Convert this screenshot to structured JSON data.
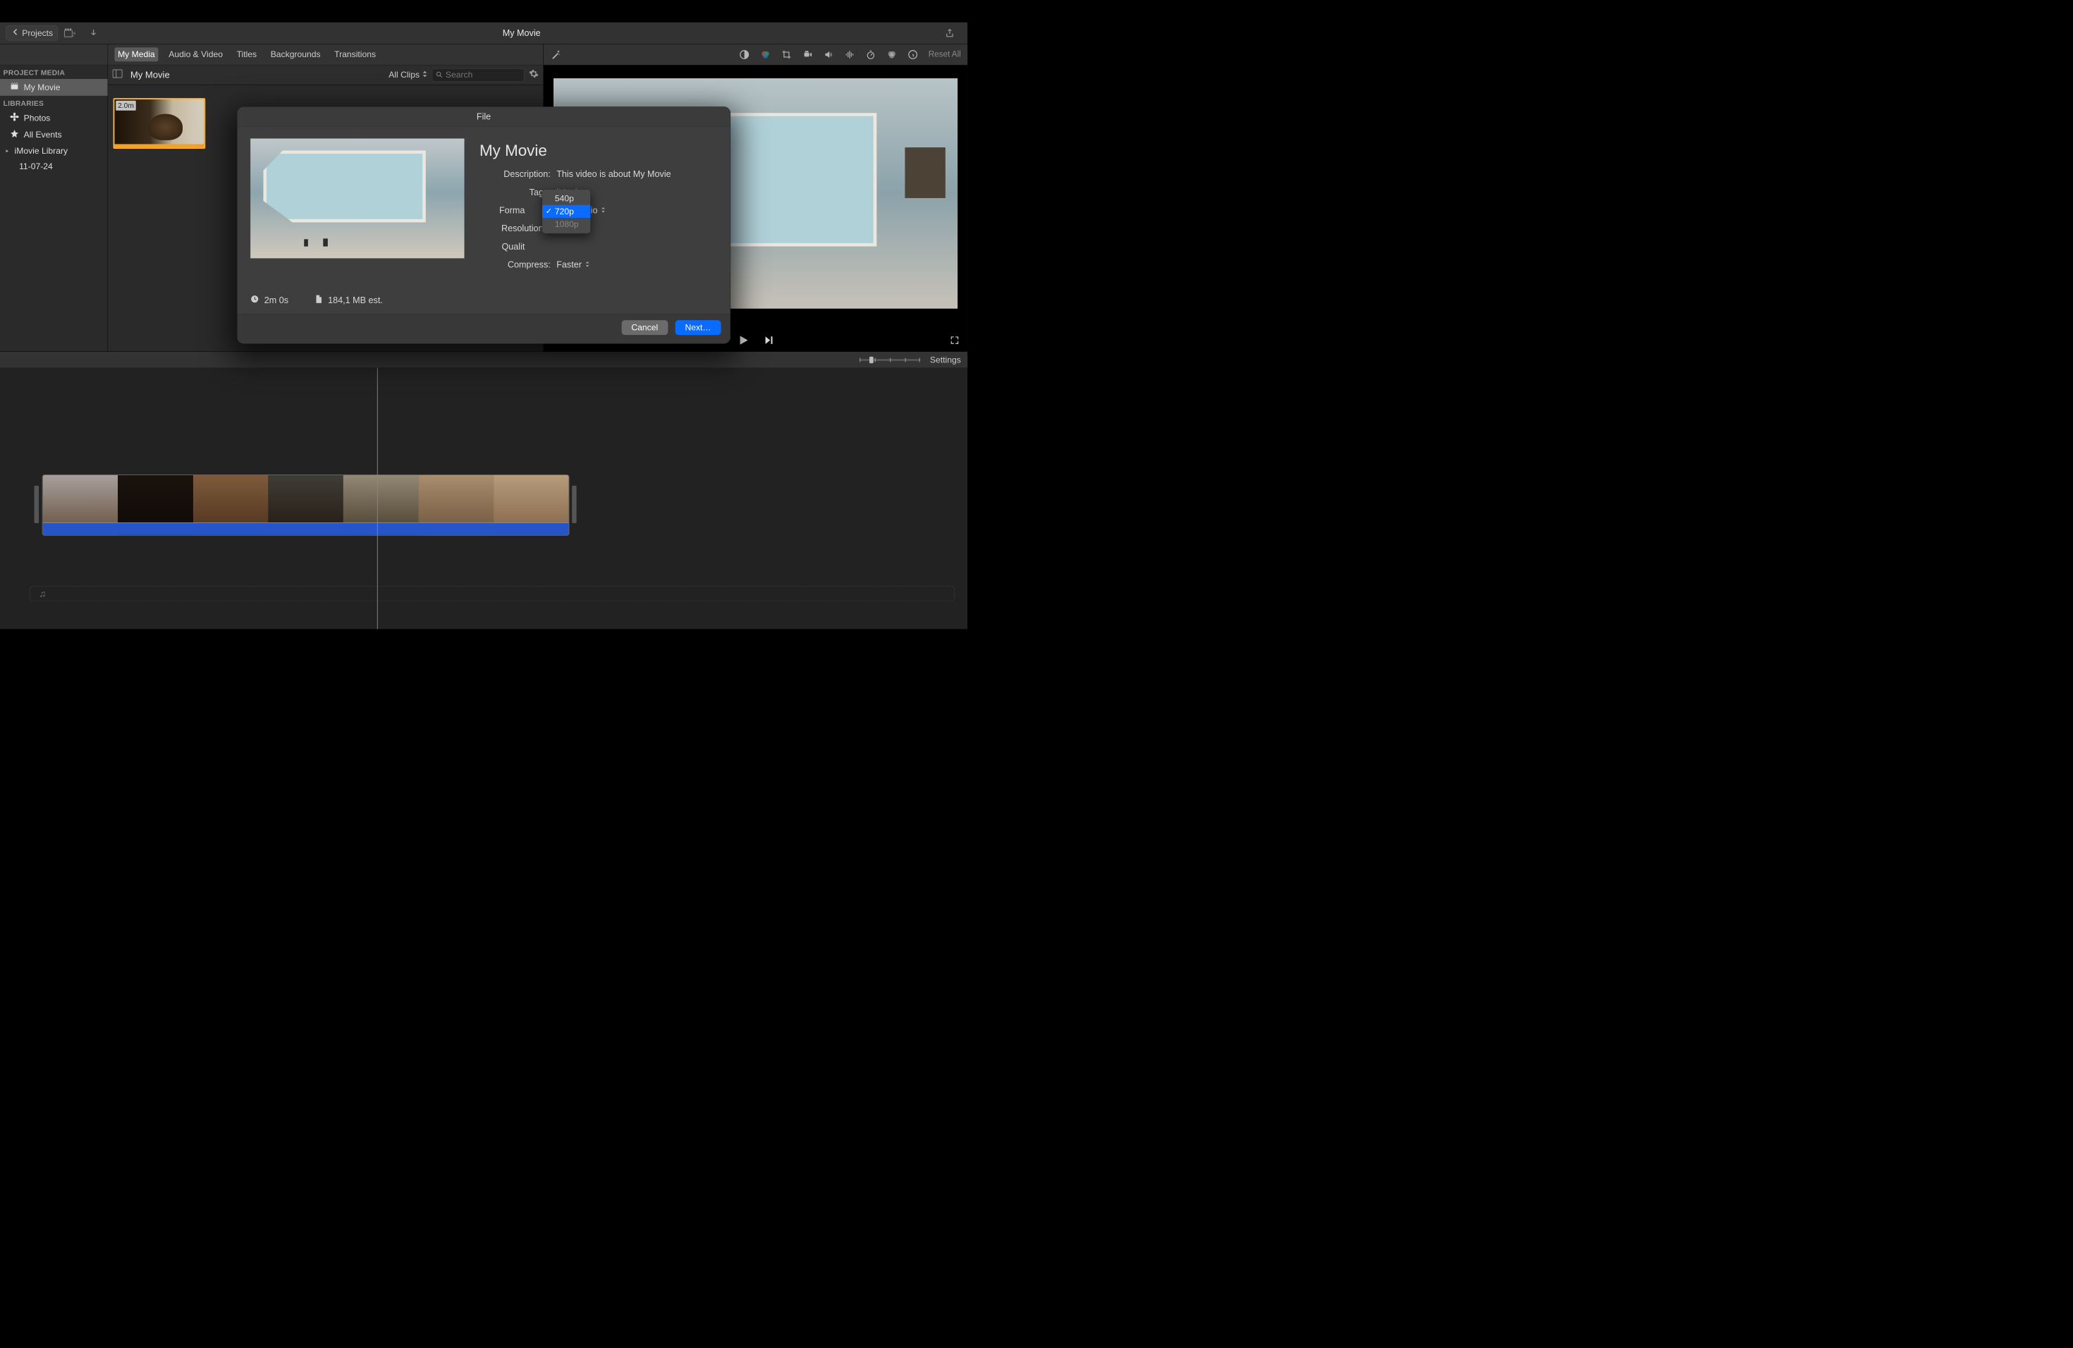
{
  "toolbar": {
    "projects_label": "Projects",
    "app_title": "My Movie"
  },
  "tabs": [
    "My Media",
    "Audio & Video",
    "Titles",
    "Backgrounds",
    "Transitions"
  ],
  "active_tab": "My Media",
  "preview_toolbar": {
    "reset_label": "Reset All"
  },
  "sidebar": {
    "headers": {
      "project_media": "PROJECT MEDIA",
      "libraries": "LIBRARIES"
    },
    "items": {
      "my_movie": "My Movie",
      "photos": "Photos",
      "all_events": "All Events",
      "imovie_library": "iMovie Library",
      "date": "11-07-24"
    }
  },
  "media_panel": {
    "title": "My Movie",
    "filter": "All Clips",
    "search_placeholder": "Search",
    "clip_badge": "2.0m"
  },
  "timeline": {
    "settings_label": "Settings"
  },
  "modal": {
    "title": "File",
    "movie_title": "My Movie",
    "labels": {
      "description": "Description:",
      "tags": "Tags:",
      "format": "Forma",
      "resolution": "Resolution",
      "quality": "Qualit",
      "compress": "Compress:"
    },
    "values": {
      "description": "This video is about My Movie",
      "tags": "iMovie",
      "format_suffix": " Audio",
      "compress": "Faster"
    },
    "meta": {
      "duration": "2m 0s",
      "filesize": "184,1 MB est."
    },
    "buttons": {
      "cancel": "Cancel",
      "next": "Next…"
    }
  },
  "dropdown": {
    "options": [
      "540p",
      "720p",
      "1080p"
    ],
    "selected": "720p",
    "disabled": [
      "1080p"
    ]
  }
}
